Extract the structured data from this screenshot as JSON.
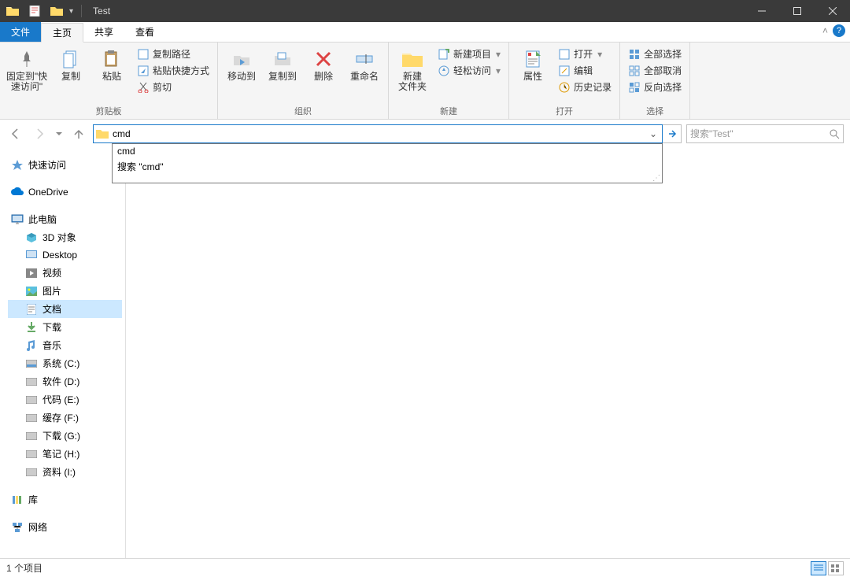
{
  "window": {
    "title": "Test"
  },
  "tabs": {
    "file": "文件",
    "home": "主页",
    "share": "共享",
    "view": "查看"
  },
  "ribbon": {
    "clipboard": {
      "pin": "固定到\"快\n速访问\"",
      "copy": "复制",
      "paste": "粘贴",
      "copypath": "复制路径",
      "pasteshortcut": "粘贴快捷方式",
      "cut": "剪切",
      "label": "剪贴板"
    },
    "organize": {
      "moveto": "移动到",
      "copyto": "复制到",
      "delete": "删除",
      "rename": "重命名",
      "label": "组织"
    },
    "new": {
      "newfolder": "新建\n文件夹",
      "newitem": "新建项目",
      "easyaccess": "轻松访问",
      "label": "新建"
    },
    "open": {
      "properties": "属性",
      "open": "打开",
      "edit": "编辑",
      "history": "历史记录",
      "label": "打开"
    },
    "select": {
      "selectall": "全部选择",
      "selectnone": "全部取消",
      "invert": "反向选择",
      "label": "选择"
    }
  },
  "address": {
    "value": "cmd"
  },
  "autocomplete": {
    "item1": "cmd",
    "item2": "搜索 \"cmd\""
  },
  "search": {
    "placeholder": "搜索\"Test\""
  },
  "sidebar": {
    "quickaccess": "快速访问",
    "onedrive": "OneDrive",
    "thispc": "此电脑",
    "objects3d": "3D 对象",
    "desktop": "Desktop",
    "videos": "视频",
    "pictures": "图片",
    "documents": "文档",
    "downloads": "下载",
    "music": "音乐",
    "drive_c": "系统 (C:)",
    "drive_d": "软件 (D:)",
    "drive_e": "代码 (E:)",
    "drive_f": "缓存 (F:)",
    "drive_g": "下载 (G:)",
    "drive_h": "笔记 (H:)",
    "drive_i": "资料 (I:)",
    "libraries": "库",
    "network": "网络"
  },
  "status": {
    "items": "1 个项目"
  }
}
